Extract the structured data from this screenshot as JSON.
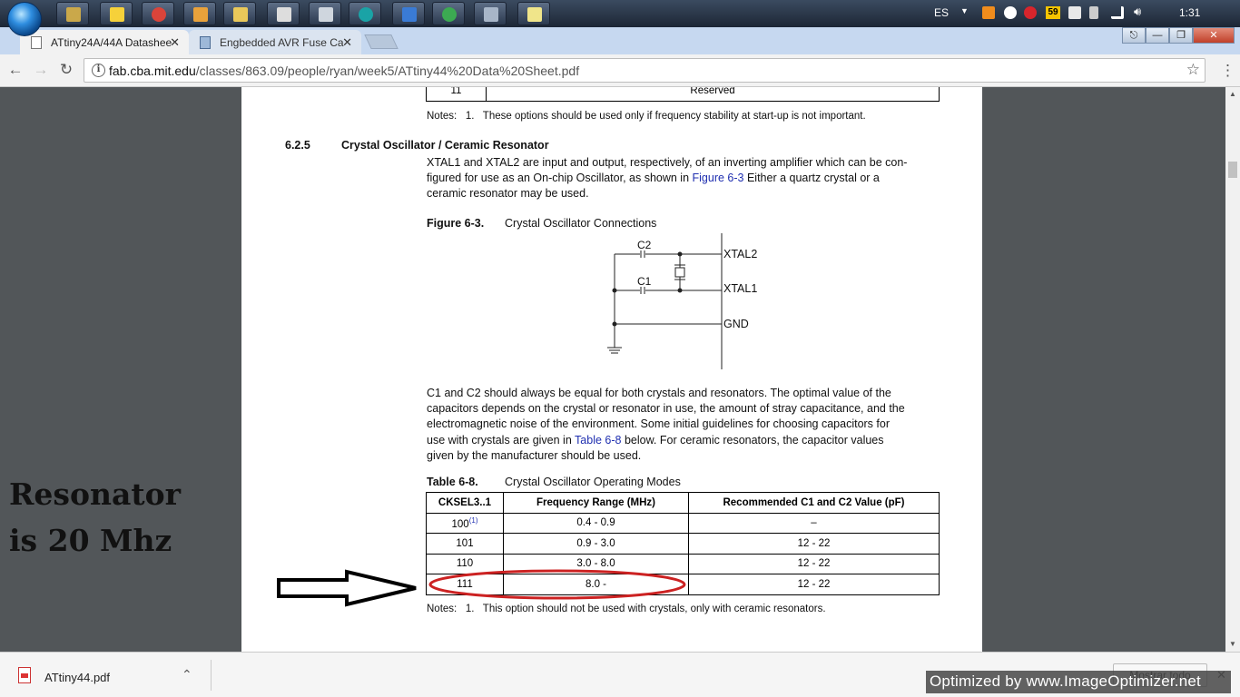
{
  "taskbar": {
    "language": "ES",
    "badge": "59",
    "clock": "1:31"
  },
  "tabs": [
    {
      "label": "ATtiny24A/44A Datashee",
      "active": true
    },
    {
      "label": "Engbedded AVR Fuse Ca",
      "active": false
    }
  ],
  "address": {
    "domain": "fab.cba.mit.edu",
    "path": "/classes/863.09/people/ryan/week5/ATtiny44%20Data%20Sheet.pdf"
  },
  "page": {
    "top_table_row": {
      "code": "11",
      "value": "Reserved"
    },
    "notes1": "Notes:   1.   These options should be used only if frequency stability at start-up is not important.",
    "section_number": "6.2.5",
    "section_title": "Crystal Oscillator / Ceramic Resonator",
    "para1_line1": "XTAL1 and XTAL2 are input and output, respectively, of an inverting amplifier which can be con-",
    "para1_line2_pre": "figured for use as an On-chip Oscillator, as shown in ",
    "para1_link": "Figure 6-3",
    "para1_line2_post": " Either a quartz crystal or a",
    "para1_line3": "ceramic resonator may be used.",
    "figure_label": "Figure 6-3.",
    "figure_title": "Crystal Oscillator Connections",
    "diagram": {
      "c2": "C2",
      "c1": "C1",
      "xtal2": "XTAL2",
      "xtal1": "XTAL1",
      "gnd": "GND"
    },
    "para2_lines": [
      "C1 and C2 should always be equal for both crystals and resonators. The optimal value of the",
      "capacitors depends on the crystal or resonator in use, the amount of stray capacitance, and the",
      "electromagnetic noise of the environment. Some initial guidelines for choosing capacitors for"
    ],
    "para2_line4_pre": "use with crystals are given in ",
    "para2_link": "Table 6-8",
    "para2_line4_post": " below. For ceramic resonators, the capacitor values",
    "para2_line5": "given by the manufacturer should be used.",
    "table_label": "Table 6-8.",
    "table_title": "Crystal Oscillator Operating Modes",
    "table_headers": [
      "CKSEL3..1",
      "Frequency Range (MHz)",
      "Recommended C1 and C2 Value (pF)"
    ],
    "table_rows": [
      {
        "cksel": "100",
        "sup": "(1)",
        "range": "0.4 - 0.9",
        "value": "–"
      },
      {
        "cksel": "101",
        "sup": "",
        "range": "0.9 - 3.0",
        "value": "12 - 22"
      },
      {
        "cksel": "110",
        "sup": "",
        "range": "3.0 - 8.0",
        "value": "12 - 22"
      },
      {
        "cksel": "111",
        "sup": "",
        "range": "8.0 -",
        "value": "12 - 22"
      }
    ],
    "notes2": "Notes:   1.   This option should not be used with crystals, only with ceramic resonators."
  },
  "annotation": {
    "line1": "Resonator",
    "line2": "is 20 Mhz",
    "arrow_color": "#000000",
    "ellipse_color": "#cc2222"
  },
  "downloads": {
    "file": "ATtiny44.pdf",
    "show_all": "Mostrar todo"
  },
  "watermark": "Optimized by www.ImageOptimizer.net"
}
